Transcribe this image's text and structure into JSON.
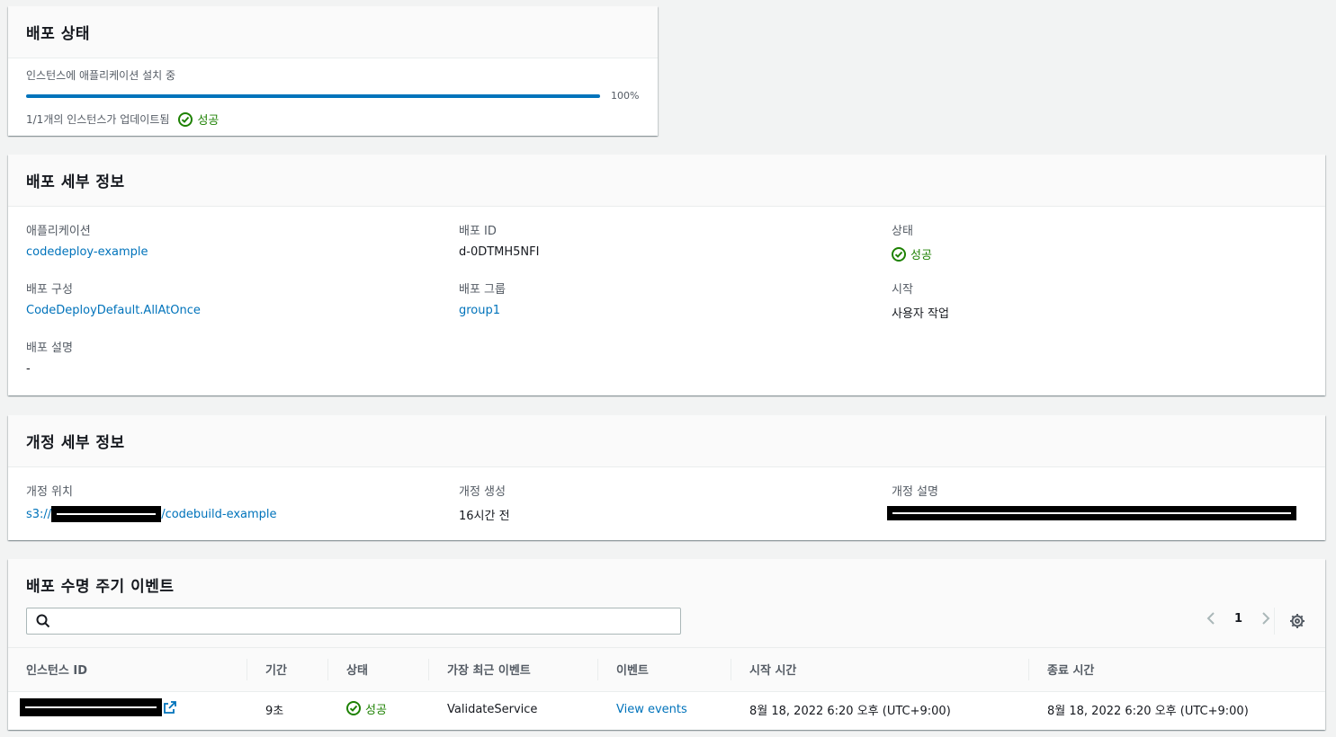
{
  "status_panel": {
    "title": "배포 상태",
    "progress_label": "인스턴스에 애플리케이션 설치 중",
    "progress_percent": 100,
    "progress_text": "100%",
    "instances_updated": "1/1개의 인스턴스가 업데이트됨",
    "status": "성공"
  },
  "details_panel": {
    "title": "배포 세부 정보",
    "fields": {
      "application_label": "애플리케이션",
      "application_value": "codedeploy-example",
      "deployment_id_label": "배포 ID",
      "deployment_id_value": "d-0DTMH5NFI",
      "status_label": "상태",
      "status_value": "성공",
      "config_label": "배포 구성",
      "config_value": "CodeDeployDefault.AllAtOnce",
      "group_label": "배포 그룹",
      "group_value": "group1",
      "start_label": "시작",
      "start_value": "사용자 작업",
      "description_label": "배포 설명",
      "description_value": "-"
    }
  },
  "revision_panel": {
    "title": "개정 세부 정보",
    "location_label": "개정 위치",
    "location_prefix": "s3://",
    "location_suffix": "/codebuild-example",
    "created_label": "개정 생성",
    "created_value": "16시간 전",
    "description_label": "개정 설명"
  },
  "events_panel": {
    "title": "배포 수명 주기 이벤트",
    "search_placeholder": "",
    "page": "1",
    "columns": [
      "인스턴스 ID",
      "기간",
      "상태",
      "가장 최근 이벤트",
      "이벤트",
      "시작 시간",
      "종료 시간"
    ],
    "rows": [
      {
        "duration": "9초",
        "status": "성공",
        "latest_event": "ValidateService",
        "events_link": "View events",
        "start_time": "8월 18, 2022 6:20 오후 (UTC+9:00)",
        "end_time": "8월 18, 2022 6:20 오후 (UTC+9:00)"
      }
    ]
  },
  "colors": {
    "link": "#0073bb",
    "success": "#1d8102",
    "progress": "#0073bb"
  }
}
